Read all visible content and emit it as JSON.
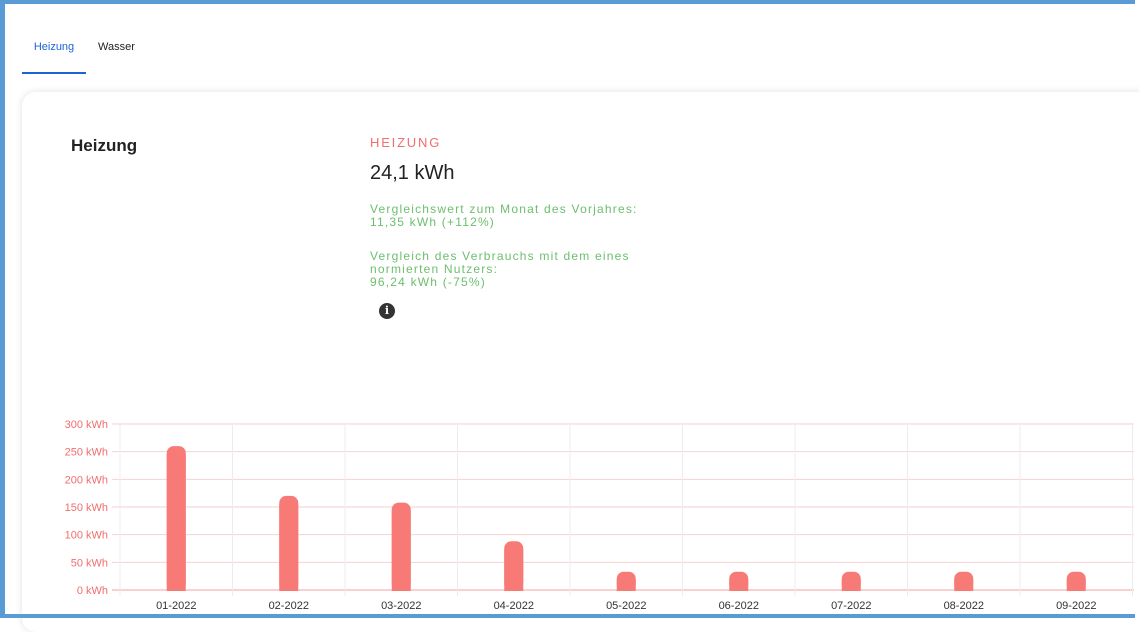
{
  "tabs": [
    {
      "label": "Heizung",
      "active": true
    },
    {
      "label": "Wasser",
      "active": false
    }
  ],
  "card": {
    "title": "Heizung",
    "kpi_label": "HEIZUNG",
    "kpi_value": "24,1 kWh",
    "comparison_prev_year": "Vergleichswert zum Monat des Vorjahres:\n11,35 kWh (+112%)",
    "comparison_norm_user": "Vergleich des Verbrauchs mit dem eines\nnormierten Nutzers:\n96,24 kWh (-75%)",
    "info_icon": "info-icon"
  },
  "colors": {
    "accent": "#1e63d6",
    "bar": "#f87a77",
    "kpi_label": "#f26d6d",
    "comparison": "#6cbf6e"
  },
  "chart_data": {
    "type": "bar",
    "categories": [
      "01-2022",
      "02-2022",
      "03-2022",
      "04-2022",
      "05-2022",
      "06-2022",
      "07-2022",
      "08-2022",
      "09-2022"
    ],
    "values": [
      260,
      170,
      158,
      88,
      33,
      33,
      33,
      33,
      33
    ],
    "y_unit": "kWh",
    "ylim": [
      0,
      300
    ],
    "yticks": [
      0,
      50,
      100,
      150,
      200,
      250,
      300
    ],
    "ytick_labels": [
      "0 kWh",
      "50 kWh",
      "100 kWh",
      "150 kWh",
      "200 kWh",
      "250 kWh",
      "300 kWh"
    ],
    "grid": true,
    "title": "",
    "xlabel": "",
    "ylabel": ""
  }
}
